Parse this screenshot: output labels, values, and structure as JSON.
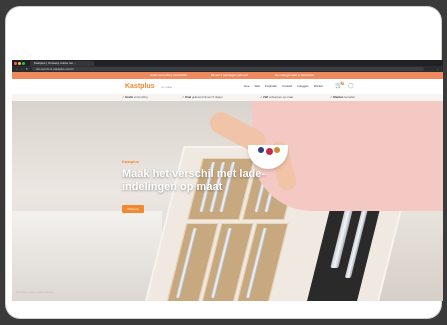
{
  "browser": {
    "tab_title": "Kastplus | Ontwerp online uw ...",
    "url": "orti.com/nl-nl  |  kastplus.com/nl",
    "window_controls": [
      "close-dot",
      "minimize-dot",
      "maximize-dot"
    ]
  },
  "promo_bar": {
    "messages": [
      "Gratis verzending vanaf €100",
      "Binnen 5 werkdagen geleverd",
      "Op maat gemaakt in Nederland"
    ]
  },
  "nav": {
    "logo_text": "Kastplus",
    "logo_sub": "op maat",
    "menu": [
      "Hoe",
      "Wat",
      "Inspiratie",
      "Contact",
      "Inloggen",
      "Winkel"
    ],
    "cart_count": "0"
  },
  "usp_bar": {
    "items": [
      {
        "strong": "Gratis",
        "text": "verzending"
      },
      {
        "strong": "Snel",
        "text": "geleverd binnen 5 dagen"
      },
      {
        "strong": "Zelf",
        "text": "ontwerpen op maat"
      },
      {
        "strong": "Klanten",
        "text": "tevreden"
      }
    ]
  },
  "hero": {
    "label": "Kastplus",
    "title": "Maak het verschil met lade-indelingen op maat",
    "button": "Ontwerp"
  },
  "footer": {
    "text": "Ontwerp zelf je lade-indeling"
  },
  "colors": {
    "accent": "#f08a30",
    "promo": "#ef8a5e"
  }
}
